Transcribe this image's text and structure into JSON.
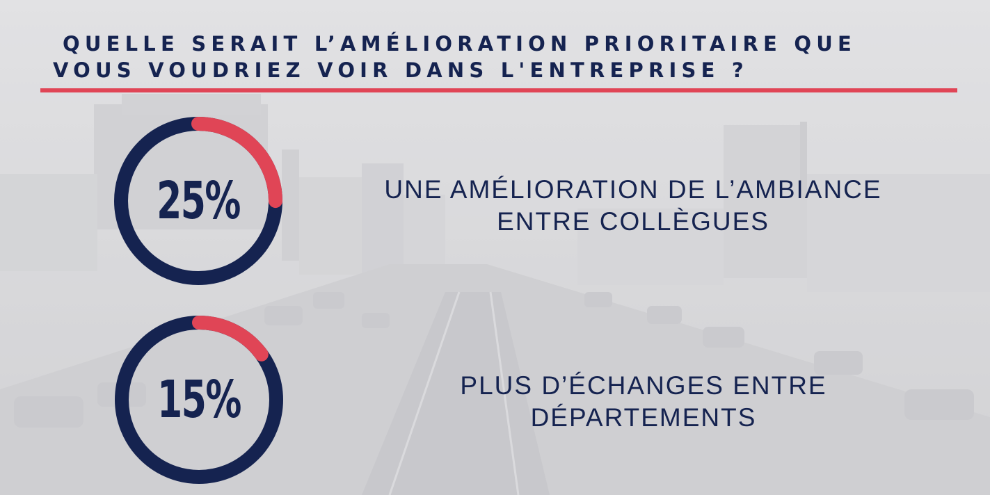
{
  "title": {
    "line1": "QUELLE SERAIT L’AMÉLIORATION PRIORITAIRE QUE",
    "line2": "VOUS VOUDRIEZ VOIR DANS L'ENTREPRISE ?"
  },
  "colors": {
    "navy": "#152350",
    "accent": "#e04556"
  },
  "background_image": "city-highway-traffic-photo (grayscale, faded)",
  "stats": [
    {
      "percent_text": "25%",
      "value": 25,
      "label_line1": "UNE AMÉLIORATION DE L’AMBIANCE",
      "label_line2": "ENTRE COLLÈGUES"
    },
    {
      "percent_text": "15%",
      "value": 15,
      "label_line1": "PLUS D’ÉCHANGES ENTRE",
      "label_line2": "DÉPARTEMENTS"
    }
  ]
}
